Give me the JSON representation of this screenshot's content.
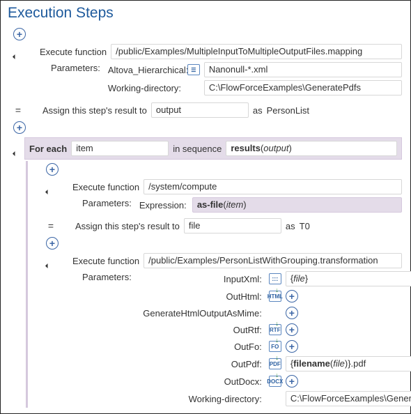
{
  "title": "Execution Steps",
  "labels": {
    "execFunction": "Execute function",
    "parameters": "Parameters:",
    "assignResult": "Assign this step's result to",
    "as": "as",
    "forEach": "For each",
    "inSequence": "in sequence"
  },
  "step1": {
    "functionPath": "/public/Examples/MultipleInputToMultipleOutputFiles.mapping",
    "params": {
      "altova": {
        "label": "Altova_Hierarchical:",
        "value": "Nanonull-*.xml"
      },
      "wd": {
        "label": "Working-directory:",
        "value": "C:\\FlowForceExamples\\GeneratePdfs"
      }
    },
    "resultVar": "output",
    "resultType": "PersonList"
  },
  "forEach": {
    "itemVar": "item",
    "seqFn": "results",
    "seqArg": "output"
  },
  "step2": {
    "functionPath": "/system/compute",
    "params": {
      "expr": {
        "label": "Expression:",
        "fn": "as-file",
        "arg": "item"
      }
    },
    "resultVar": "file",
    "resultType": "T0"
  },
  "step3": {
    "functionPath": "/public/Examples/PersonListWithGrouping.transformation",
    "params": {
      "inputXml": {
        "label": "InputXml:",
        "icon": ":::",
        "value_fn": "",
        "value_arg": "file",
        "wrapBraces": true
      },
      "outHtml": {
        "label": "OutHtml:",
        "icon": "HTML"
      },
      "genMime": {
        "label": "GenerateHtmlOutputAsMime:"
      },
      "outRtf": {
        "label": "OutRtf:",
        "icon": "RTF"
      },
      "outFo": {
        "label": "OutFo:",
        "icon": "FO"
      },
      "outPdf": {
        "label": "OutPdf:",
        "icon": "PDF",
        "value_fn": "filename",
        "value_arg": "file",
        "value_suffix": ".pdf",
        "wrapBraces": true
      },
      "outDocx": {
        "label": "OutDocx:",
        "icon": "DOCX"
      },
      "wd": {
        "label": "Working-directory:",
        "value": "C:\\FlowForceExamples\\GeneratePdfs"
      }
    }
  }
}
